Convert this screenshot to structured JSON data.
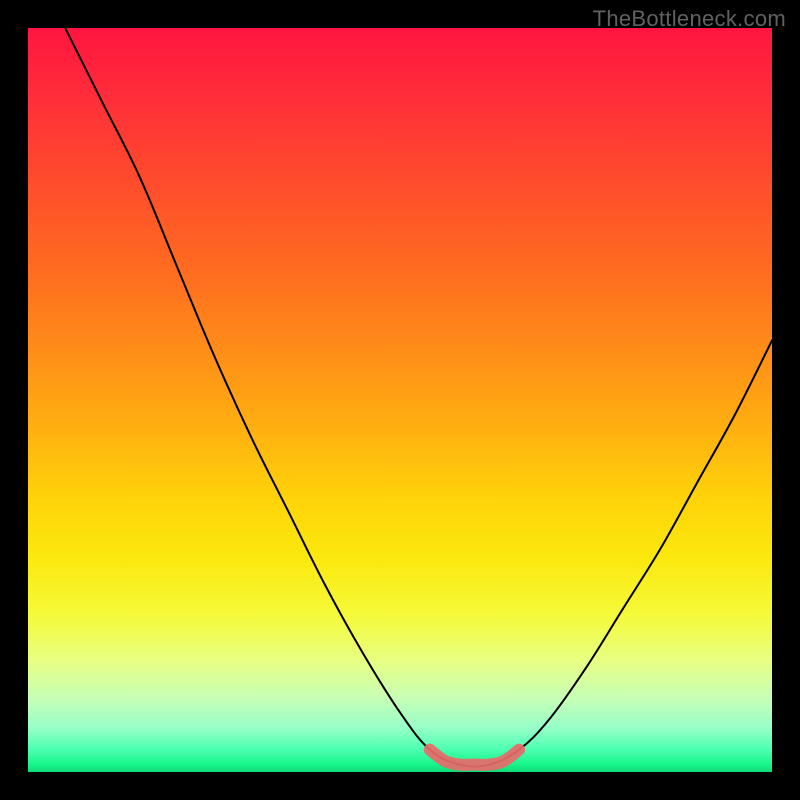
{
  "watermark": "TheBottleneck.com",
  "chart_data": {
    "type": "line",
    "title": "",
    "xlabel": "",
    "ylabel": "",
    "xlim": [
      0,
      100
    ],
    "ylim": [
      0,
      100
    ],
    "grid": false,
    "legend": false,
    "series": [
      {
        "name": "bottleneck-curve",
        "color": "#000000",
        "x": [
          5,
          10,
          15,
          20,
          25,
          30,
          35,
          40,
          45,
          50,
          54,
          58,
          62,
          66,
          70,
          75,
          80,
          85,
          90,
          95,
          100
        ],
        "values": [
          100,
          90,
          80,
          68,
          56,
          45,
          35,
          25,
          16,
          8,
          3,
          1,
          1,
          3,
          7,
          14,
          22,
          30,
          39,
          48,
          58
        ]
      },
      {
        "name": "optimal-zone-marker",
        "color": "#e86a6a",
        "x": [
          54,
          56,
          58,
          60,
          62,
          64,
          66
        ],
        "values": [
          3,
          1.5,
          1,
          1,
          1,
          1.5,
          3
        ]
      }
    ]
  }
}
